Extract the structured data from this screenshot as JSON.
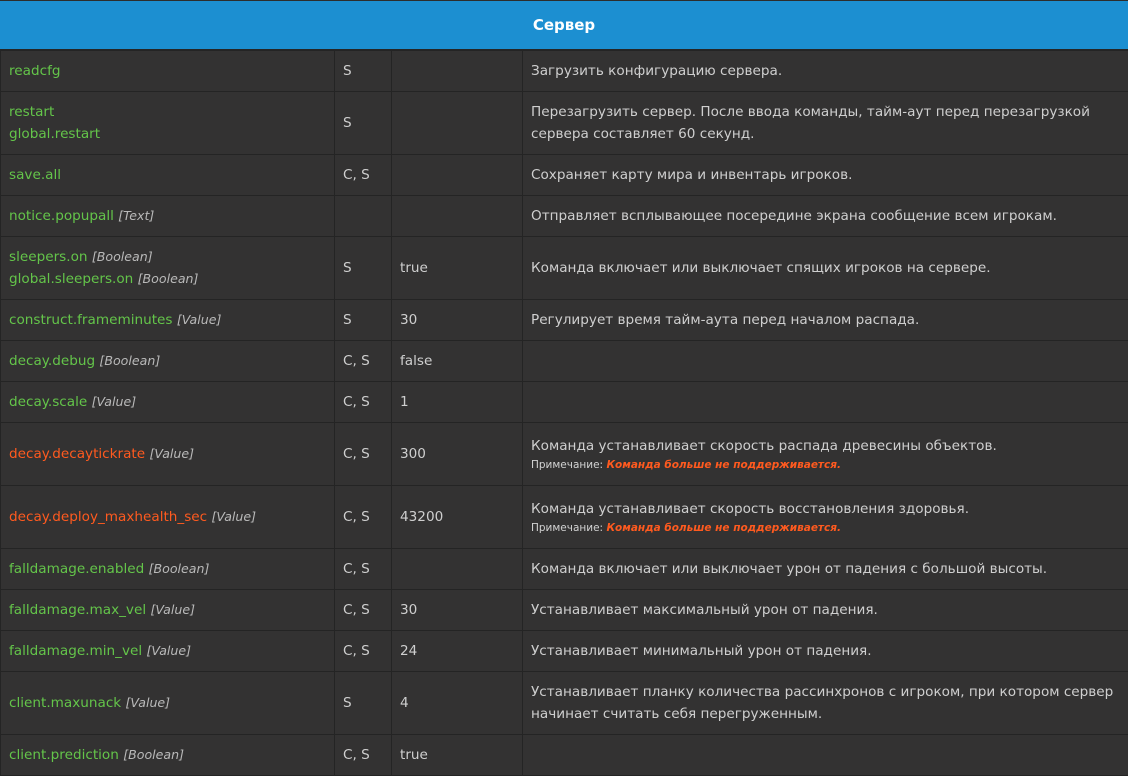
{
  "header": {
    "title": "Сервер"
  },
  "colors": {
    "header": "#1c8fd1",
    "command": "#64c54a",
    "deprecated": "#ff5a1f",
    "background": "#333232"
  },
  "rows": [
    {
      "cmd": "readcfg",
      "type": "",
      "cmd2": "",
      "type2": "",
      "scope": "S",
      "value": "",
      "desc": "Загрузить конфигурацию сервера."
    },
    {
      "cmd": "restart",
      "type": "",
      "cmd2": "global.restart",
      "type2": "",
      "scope": "S",
      "value": "",
      "desc": "Перезагрузить сервер. После ввода команды, тайм-аут перед перезагрузкой сервера составляет 60 секунд."
    },
    {
      "cmd": "save.all",
      "type": "",
      "cmd2": "",
      "type2": "",
      "scope": "C, S",
      "value": "",
      "desc": "Сохраняет карту мира и инвентарь игроков."
    },
    {
      "cmd": "notice.popupall",
      "type": "[Text]",
      "cmd2": "",
      "type2": "",
      "scope": "",
      "value": "",
      "desc": "Отправляет всплывающее посередине экрана сообщение всем игрокам."
    },
    {
      "cmd": "sleepers.on",
      "type": "[Boolean]",
      "cmd2": "global.sleepers.on",
      "type2": "[Boolean]",
      "scope": "S",
      "value": "true",
      "desc": "Команда включает или выключает спящих игроков на сервере."
    },
    {
      "cmd": "construct.frameminutes",
      "type": "[Value]",
      "cmd2": "",
      "type2": "",
      "scope": "S",
      "value": "30",
      "desc": "Регулирует время тайм-аута перед началом распада."
    },
    {
      "cmd": "decay.debug",
      "type": "[Boolean]",
      "cmd2": "",
      "type2": "",
      "scope": "C, S",
      "value": "false",
      "desc": ""
    },
    {
      "cmd": "decay.scale",
      "type": "[Value]",
      "cmd2": "",
      "type2": "",
      "scope": "C, S",
      "value": "1",
      "desc": ""
    },
    {
      "cmd": "decay.decaytickrate",
      "type": "[Value]",
      "cmd2": "",
      "type2": "",
      "scope": "C, S",
      "value": "300",
      "desc": "Команда устанавливает скорость распада древесины объектов.",
      "note_label": "Примечание:",
      "note_text": "Команда больше не поддерживается."
    },
    {
      "cmd": "decay.deploy_maxhealth_sec",
      "type": "[Value]",
      "cmd2": "",
      "type2": "",
      "scope": "C, S",
      "value": "43200",
      "desc": "Команда устанавливает скорость восстановления здоровья.",
      "note_label": "Примечание:",
      "note_text": "Команда больше не поддерживается."
    },
    {
      "cmd": "falldamage.enabled",
      "type": "[Boolean]",
      "cmd2": "",
      "type2": "",
      "scope": "C, S",
      "value": "",
      "desc": "Команда включает или выключает урон от падения с большой высоты."
    },
    {
      "cmd": "falldamage.max_vel",
      "type": "[Value]",
      "cmd2": "",
      "type2": "",
      "scope": "C, S",
      "value": "30",
      "desc": "Устанавливает максимальный урон от падения."
    },
    {
      "cmd": "falldamage.min_vel",
      "type": "[Value]",
      "cmd2": "",
      "type2": "",
      "scope": "C, S",
      "value": "24",
      "desc": "Устанавливает минимальный урон от падения."
    },
    {
      "cmd": "client.maxunack",
      "type": "[Value]",
      "cmd2": "",
      "type2": "",
      "scope": "S",
      "value": "4",
      "desc": "Устанавливает планку количества рассинхронов с игроком, при котором сервер начинает считать себя перегруженным."
    },
    {
      "cmd": "client.prediction",
      "type": "[Boolean]",
      "cmd2": "",
      "type2": "",
      "scope": "C, S",
      "value": "true",
      "desc": ""
    }
  ]
}
